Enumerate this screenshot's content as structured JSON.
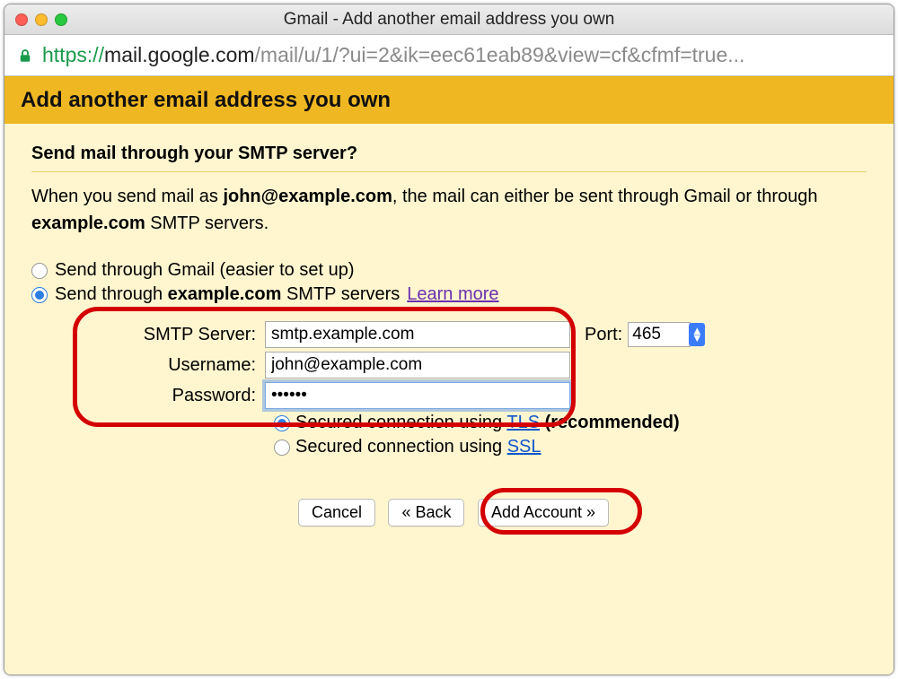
{
  "window": {
    "title": "Gmail - Add another email address you own"
  },
  "url": {
    "https": "https://",
    "host": "mail.google.com",
    "path": "/mail/u/1/?ui=2&ik=eec61eab89&view=cf&cfmf=true..."
  },
  "banner": "Add another email address you own",
  "subhead": "Send mail through your SMTP server?",
  "intro": {
    "t1": "When you send mail as ",
    "addr": "john@example.com",
    "t2": ", the mail can either be sent through Gmail or through ",
    "domain": "example.com",
    "t3": " SMTP servers."
  },
  "radio1": "Send through Gmail (easier to set up)",
  "radio2a": "Send through ",
  "radio2domain": "example.com",
  "radio2b": " SMTP servers ",
  "learn": "Learn more",
  "form": {
    "smtp_label": "SMTP Server:",
    "smtp_value": "smtp.example.com",
    "port_label": "Port:",
    "port_value": "465",
    "user_label": "Username:",
    "user_value": "john@example.com",
    "pass_label": "Password:",
    "pass_value": "••••••"
  },
  "sec": {
    "tls_a": "Secured connection using ",
    "tls_link": "TLS",
    "tls_b": " (recommended)",
    "ssl_a": "Secured connection using ",
    "ssl_link": "SSL"
  },
  "buttons": {
    "cancel": "Cancel",
    "back": "« Back",
    "add": "Add Account »"
  }
}
